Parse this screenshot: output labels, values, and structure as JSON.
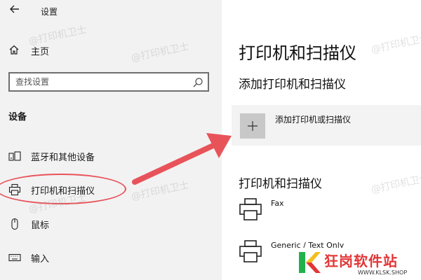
{
  "window": {
    "title": "设置",
    "back_icon": "arrow-left-icon"
  },
  "sidebar": {
    "home_label": "主页",
    "search_placeholder": "查找设置",
    "section_heading": "设备",
    "items": [
      {
        "label": "蓝牙和其他设备",
        "icon": "devices-icon"
      },
      {
        "label": "打印机和扫描仪",
        "icon": "printer-icon",
        "selected": true
      },
      {
        "label": "鼠标",
        "icon": "mouse-icon"
      },
      {
        "label": "输入",
        "icon": "keyboard-icon"
      }
    ]
  },
  "main": {
    "title": "打印机和扫描仪",
    "add_section_title": "添加打印机和扫描仪",
    "add_button_label": "添加打印机或扫描仪",
    "list_section_title": "打印机和扫描仪",
    "printers": [
      {
        "name": "Fax"
      },
      {
        "name": "Generic / Text Only"
      }
    ]
  },
  "watermark_text": "@打印机卫士",
  "logo": {
    "brand": "狂岗软件站",
    "url": "WWW.KLSK.SHOP"
  },
  "colors": {
    "annotation_red": "#e8535a",
    "brand_red": "#e23636"
  }
}
